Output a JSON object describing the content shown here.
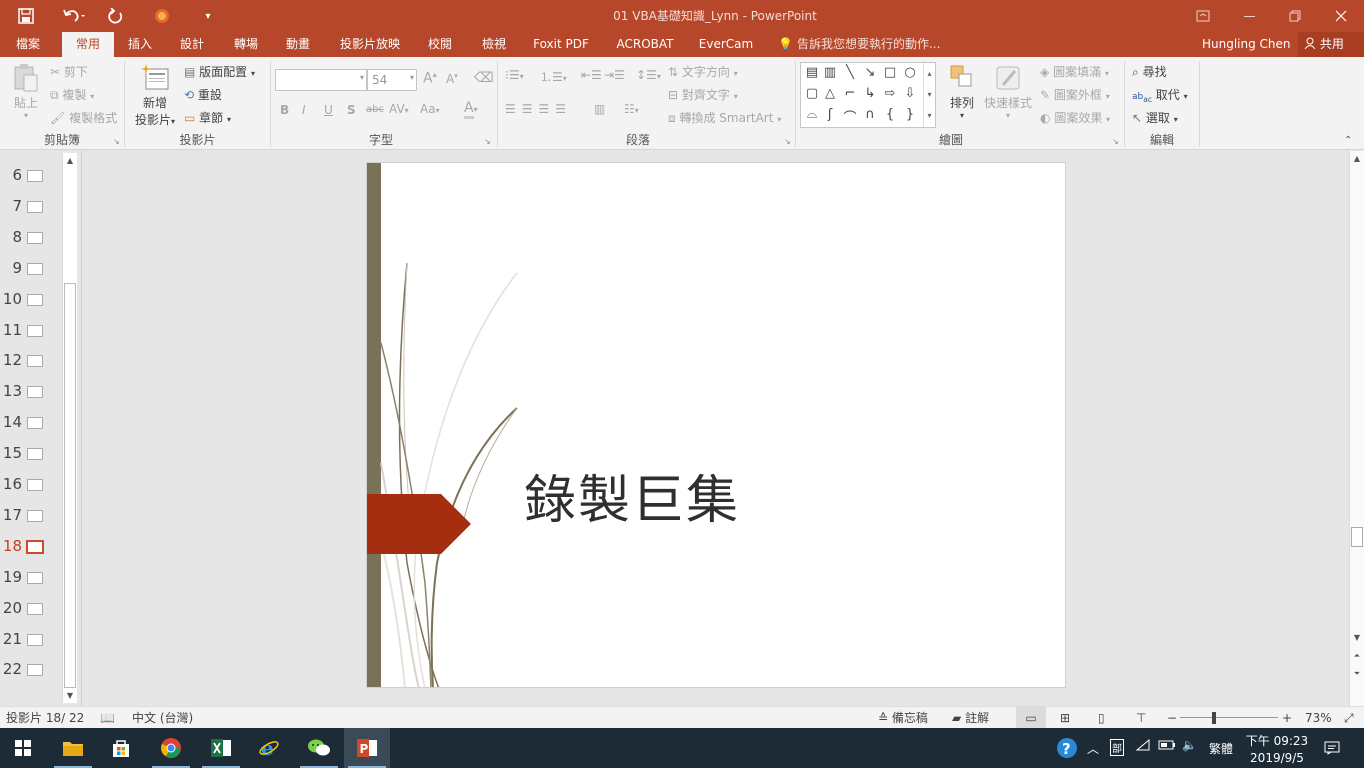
{
  "window": {
    "title": "01 VBA基礎知識_Lynn - PowerPoint"
  },
  "tabs": [
    "檔案",
    "常用",
    "插入",
    "設計",
    "轉場",
    "動畫",
    "投影片放映",
    "校閱",
    "檢視",
    "Foxit PDF",
    "ACROBAT",
    "EverCam"
  ],
  "active_tab": "常用",
  "tell_me": "告訴我您想要執行的動作...",
  "user": "Hungling Chen",
  "share": "共用",
  "ribbon": {
    "clipboard": {
      "label": "剪貼簿",
      "paste": "貼上",
      "cut": "剪下",
      "copy": "複製",
      "format_painter": "複製格式"
    },
    "slides": {
      "label": "投影片",
      "new_slide_1": "新增",
      "new_slide_2": "投影片",
      "layout": "版面配置",
      "reset": "重設",
      "section": "章節"
    },
    "font": {
      "label": "字型",
      "font_size": "54",
      "bold": "B",
      "italic": "I",
      "underline": "U",
      "shadow": "S",
      "strike": "abc",
      "spacing": "AV",
      "case": "Aa",
      "color": "A"
    },
    "paragraph": {
      "label": "段落",
      "text_direction": "文字方向",
      "align_text": "對齊文字",
      "smartart": "轉換成 SmartArt"
    },
    "drawing": {
      "label": "繪圖",
      "arrange": "排列",
      "quick_styles": "快速樣式",
      "shape_fill": "圖案填滿",
      "shape_outline": "圖案外框",
      "shape_effects": "圖案效果"
    },
    "editing": {
      "label": "編輯",
      "find": "尋找",
      "replace": "取代",
      "select": "選取"
    }
  },
  "thumbnails": [
    "6",
    "7",
    "8",
    "9",
    "10",
    "11",
    "12",
    "13",
    "14",
    "15",
    "16",
    "17",
    "18",
    "19",
    "20",
    "21",
    "22"
  ],
  "active_slide": "18",
  "slide": {
    "title": "錄製巨集",
    "bar_color": "#797158",
    "arrow_color": "#a42e0f"
  },
  "status": {
    "slide_info": "投影片 18/ 22",
    "language": "中文 (台灣)",
    "notes": "備忘稿",
    "comments": "註解",
    "zoom": "73%",
    "zoom_minus": "−",
    "zoom_plus": "+"
  },
  "taskbar": {
    "time": "下午 09:23",
    "date": "2019/9/5",
    "ime": "繁體"
  }
}
